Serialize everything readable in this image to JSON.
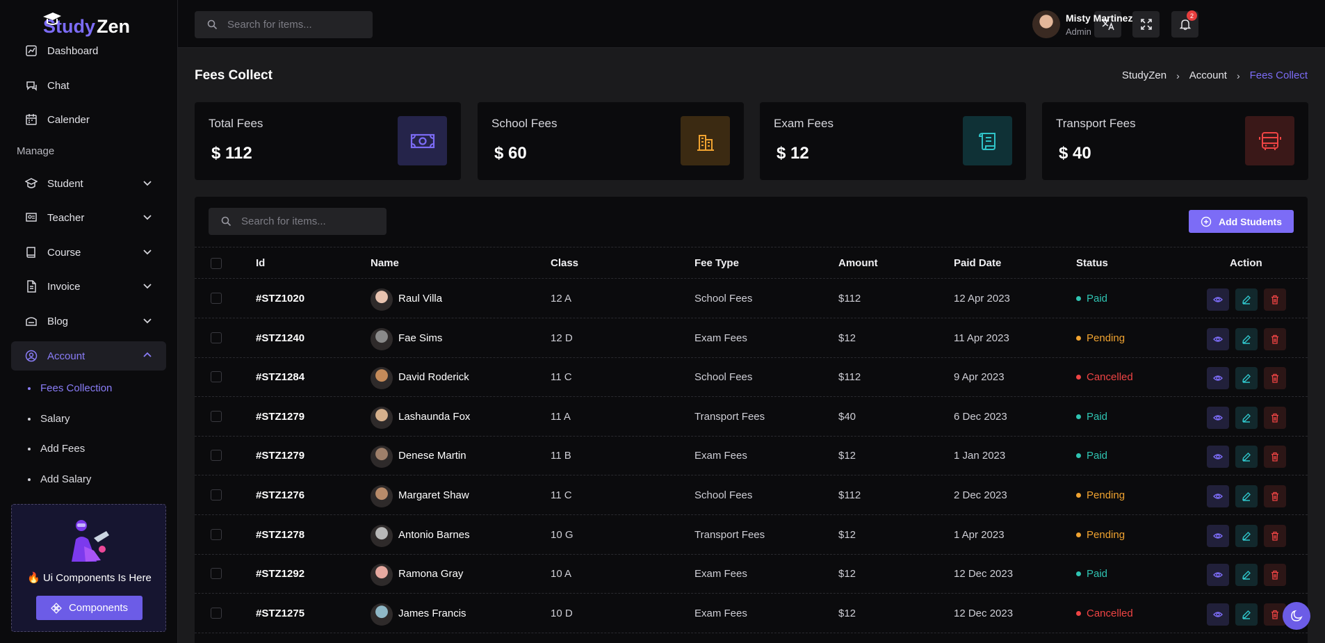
{
  "brand": {
    "name_a": "Study",
    "name_b": "Zen"
  },
  "top_search": {
    "placeholder": "Search for items..."
  },
  "notifications": {
    "count": "2"
  },
  "user": {
    "name": "Misty Martinez",
    "role": "Admin"
  },
  "sidebar": {
    "items": [
      {
        "label": "Dashboard"
      },
      {
        "label": "Chat"
      },
      {
        "label": "Calender"
      }
    ],
    "section_manage": "Manage",
    "manage_items": [
      {
        "label": "Student"
      },
      {
        "label": "Teacher"
      },
      {
        "label": "Course"
      },
      {
        "label": "Invoice"
      },
      {
        "label": "Blog"
      },
      {
        "label": "Account"
      }
    ],
    "account_sub": [
      {
        "label": "Fees Collection"
      },
      {
        "label": "Salary"
      },
      {
        "label": "Add Fees"
      },
      {
        "label": "Add Salary"
      }
    ],
    "promo": {
      "text": "🔥 Ui Components Is Here",
      "button": "Components"
    }
  },
  "page": {
    "title": "Fees Collect",
    "breadcrumb": [
      "StudyZen",
      "Account",
      "Fees Collect"
    ]
  },
  "cards": [
    {
      "label": "Total Fees",
      "value": "$ 112",
      "color": "#7c6cf6"
    },
    {
      "label": "School Fees",
      "value": "$ 60",
      "color": "#f0a330"
    },
    {
      "label": "Exam Fees",
      "value": "$ 12",
      "color": "#2fc4c9"
    },
    {
      "label": "Transport Fees",
      "value": "$ 40",
      "color": "#ef4444"
    }
  ],
  "table": {
    "search_placeholder": "Search for items...",
    "add_button": "Add Students",
    "headers": [
      "Id",
      "Name",
      "Class",
      "Fee Type",
      "Amount",
      "Paid Date",
      "Status",
      "Action"
    ],
    "rows": [
      {
        "id": "#STZ1020",
        "name": "Raul Villa",
        "class": "12 A",
        "fee_type": "School Fees",
        "amount": "$112",
        "paid_date": "12 Apr 2023",
        "status": "Paid"
      },
      {
        "id": "#STZ1240",
        "name": "Fae Sims",
        "class": "12 D",
        "fee_type": "Exam Fees",
        "amount": "$12",
        "paid_date": "11 Apr 2023",
        "status": "Pending"
      },
      {
        "id": "#STZ1284",
        "name": "David Roderick",
        "class": "11 C",
        "fee_type": "School Fees",
        "amount": "$112",
        "paid_date": "9 Apr 2023",
        "status": "Cancelled"
      },
      {
        "id": "#STZ1279",
        "name": "Lashaunda Fox",
        "class": "11 A",
        "fee_type": "Transport Fees",
        "amount": "$40",
        "paid_date": "6 Dec 2023",
        "status": "Paid"
      },
      {
        "id": "#STZ1279",
        "name": "Denese Martin",
        "class": "11 B",
        "fee_type": "Exam Fees",
        "amount": "$12",
        "paid_date": "1 Jan 2023",
        "status": "Paid"
      },
      {
        "id": "#STZ1276",
        "name": "Margaret Shaw",
        "class": "11 C",
        "fee_type": "School Fees",
        "amount": "$112",
        "paid_date": "2 Dec 2023",
        "status": "Pending"
      },
      {
        "id": "#STZ1278",
        "name": "Antonio Barnes",
        "class": "10 G",
        "fee_type": "Transport Fees",
        "amount": "$12",
        "paid_date": "1 Apr 2023",
        "status": "Pending"
      },
      {
        "id": "#STZ1292",
        "name": "Ramona Gray",
        "class": "10 A",
        "fee_type": "Exam Fees",
        "amount": "$12",
        "paid_date": "12 Dec 2023",
        "status": "Paid"
      },
      {
        "id": "#STZ1275",
        "name": "James Francis",
        "class": "10 D",
        "fee_type": "Exam Fees",
        "amount": "$12",
        "paid_date": "12 Dec 2023",
        "status": "Cancelled"
      }
    ]
  },
  "status_colors": {
    "Paid": "#2fc4b2",
    "Pending": "#f0a330",
    "Cancelled": "#ef4444"
  }
}
